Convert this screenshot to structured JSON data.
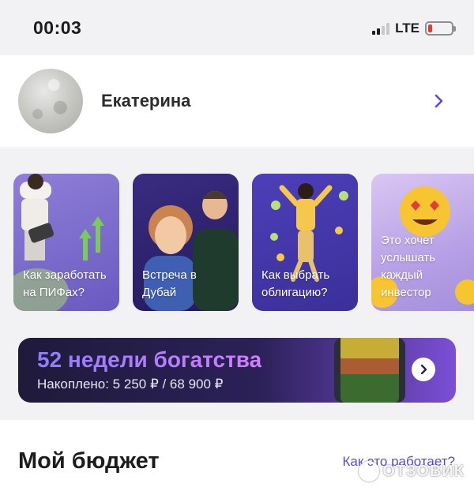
{
  "status_bar": {
    "time": "00:03",
    "network": "LTE",
    "battery_level": 0.1,
    "signal_bars": 2
  },
  "profile": {
    "name": "Екатерина"
  },
  "stories": [
    {
      "text": "Как заработать на ПИФах?"
    },
    {
      "text": "Встреча в Дубай"
    },
    {
      "text": "Как выбрать облигацию?"
    },
    {
      "text": "Это хочет услышать каждый инвестор"
    }
  ],
  "banner": {
    "title": "52 недели богатства",
    "subtitle": "Накоплено: 5 250 ₽ / 68 900 ₽"
  },
  "budget": {
    "title": "Мой бюджет",
    "link": "Как это работает?"
  },
  "watermark": {
    "text": "ОТЗОВИК"
  },
  "colors": {
    "accent": "#5b4bd6",
    "background": "#f2f2f4",
    "banner_bg": "#2b2158"
  }
}
